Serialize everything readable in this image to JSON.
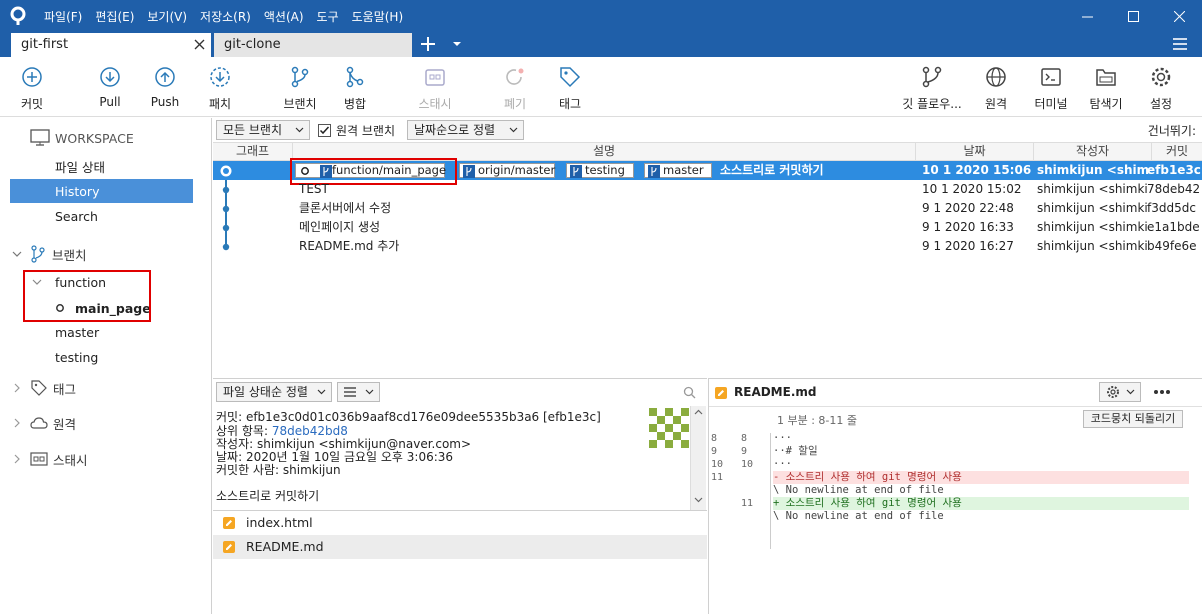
{
  "menu": [
    "파일(F)",
    "편집(E)",
    "보기(V)",
    "저장소(R)",
    "액션(A)",
    "도구",
    "도움말(H)"
  ],
  "tabs": {
    "active": "git-first",
    "other": "git-clone"
  },
  "toolbar": {
    "commit": "커밋",
    "pull": "Pull",
    "push": "Push",
    "fetch": "패치",
    "branch": "브랜치",
    "merge": "병합",
    "stash": "스태시",
    "discard": "폐기",
    "tag": "태그",
    "gitflow": "깃 플로우...",
    "remote": "원격",
    "terminal": "터미널",
    "explorer": "탐색기",
    "settings": "설정"
  },
  "sidebar": {
    "workspace": "WORKSPACE",
    "file_status": "파일 상태",
    "history": "History",
    "search": "Search",
    "branches": "브랜치",
    "function": "function",
    "main_page": "main_page",
    "master": "master",
    "testing": "testing",
    "tags": "태그",
    "remotes": "원격",
    "stashes": "스태시"
  },
  "filters": {
    "all_branches": "모든 브랜치",
    "remote_branches": "원격 브랜치",
    "sort_date": "날짜순으로 정렬",
    "skip": "건너뛰기:"
  },
  "columns": {
    "graph": "그래프",
    "desc": "설명",
    "date": "날짜",
    "author": "작성자",
    "commit": "커밋"
  },
  "commits": [
    {
      "message": "소스트리로 커밋하기",
      "date": "10 1 2020 15:06",
      "author": "shimkijun <shimk",
      "hash": "efb1e3c",
      "refs": [
        "function/main_page",
        "origin/master",
        "testing",
        "master"
      ]
    },
    {
      "message": "TEST",
      "date": "10 1 2020 15:02",
      "author": "shimkijun <shimki",
      "hash": "78deb42"
    },
    {
      "message": "클론서버에서 수정",
      "date": "9 1 2020 22:48",
      "author": "shimkijun <shimki",
      "hash": "f3dd5dc"
    },
    {
      "message": "메인페이지 생성",
      "date": "9 1 2020 16:33",
      "author": "shimkijun <shimki",
      "hash": "e1a1bde"
    },
    {
      "message": "README.md 추가",
      "date": "9 1 2020 16:27",
      "author": "shimkijun <shimki",
      "hash": "b49fe6e"
    }
  ],
  "detail": {
    "sort": "파일 상태순 정렬",
    "commit_line": "커밋: efb1e3c0d01c036b9aaf8cd176e09dee5535b3a6 [efb1e3c]",
    "parent_label": "상위 항목:",
    "parent_hash": "78deb42bd8",
    "author": "작성자: shimkijun <shimkijun@naver.com>",
    "date": "날짜: 2020년 1월 10일 금요일 오후 3:06:36",
    "committer": "커밋한 사람: shimkijun",
    "message": "소스트리로 커밋하기"
  },
  "files": [
    "index.html",
    "README.md"
  ],
  "diff": {
    "file": "README.md",
    "hunk": "1 부분 : 8-11 줄",
    "revert": "코드뭉치 되돌리기",
    "lines": [
      {
        "l": "8",
        "r": "8",
        "text": "···",
        "type": "ctx"
      },
      {
        "l": "9",
        "r": "9",
        "text": "··# 할일",
        "type": "ctx"
      },
      {
        "l": "10",
        "r": "10",
        "text": "···",
        "type": "ctx"
      },
      {
        "l": "11",
        "r": "",
        "text": "- 소스트리 사용 하여 git 명령어 사용",
        "type": "del"
      },
      {
        "l": "",
        "r": "",
        "text": "\\ No newline at end of file",
        "type": "ctx"
      },
      {
        "l": "",
        "r": "11",
        "text": "+ 소스트리 사용 하여 git 명령어 사용",
        "type": "add"
      },
      {
        "l": "",
        "r": "",
        "text": "\\ No newline at end of file",
        "type": "ctx"
      }
    ]
  },
  "colors": {
    "accent": "#1f5fa9",
    "selected": "#2d8ce0",
    "highlight": "#e00000"
  }
}
